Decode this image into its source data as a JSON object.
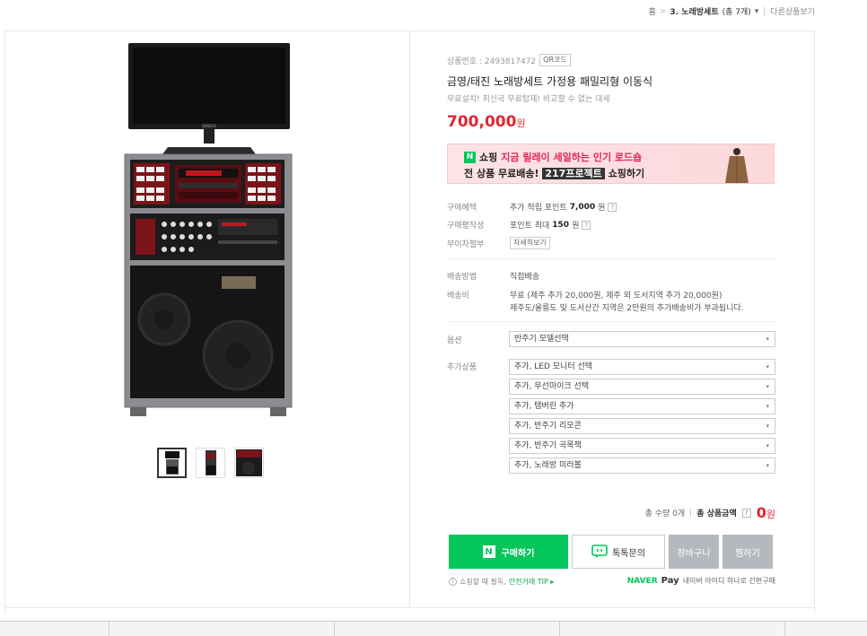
{
  "breadcrumb": {
    "home": "홈",
    "sep": ">",
    "category": "3. 노래방세트",
    "count": "(총 7개)",
    "dropdown": "▾",
    "other": "다른상품보기"
  },
  "product": {
    "number_label": "상품번호 : 2493817472",
    "qr_label": "QR코드",
    "title": "금영/태진 노래방세트 가정용 패밀리형 이동식",
    "subtitle": "무료설치! 최신곡 무료탑재! 비교할 수 없는 대세",
    "price": "700,000",
    "price_unit": "원",
    "monitor_brand": "SENSUS"
  },
  "banner": {
    "badge": "N",
    "line1_a": "쇼핑",
    "line1_b": "지금 릴레이 세일하는 인기 로드숍",
    "line2_a": "전 상품 무료배송!",
    "line2_b": "217프로젝트",
    "line2_c": "쇼핑하기"
  },
  "benefits": {
    "buy_label": "구매혜택",
    "buy_value_pre": "추가 적립 포인트",
    "buy_value_bold": "7,000",
    "buy_value_unit": "원",
    "review_label": "구매평작성",
    "review_value_pre": "포인트 최대",
    "review_value_bold": "150",
    "review_value_unit": "원",
    "installment_label": "무이자할부",
    "installment_btn": "자세히보기",
    "question": "?"
  },
  "delivery": {
    "method_label": "배송방법",
    "method_value": "직접배송",
    "fee_label": "배송비",
    "fee_line1": "무료 (제주 추가 20,000원, 제주 외 도서지역 추가 20,000원)",
    "fee_line2": "제주도/울릉도 및 도서산간 지역은 2만원의 추가배송비가 부과됩니다."
  },
  "options": {
    "option_label": "옵션",
    "option_select": "반주기 모델선택",
    "extra_label": "추가상품",
    "extras": [
      "추가, LED 모니터 선택",
      "추가, 무선마이크 선택",
      "추가, 탬버린 추가",
      "추가, 반주기 리모콘",
      "추가, 반주기 곡목책",
      "추가, 노래방 미러볼"
    ],
    "arrow": "▾"
  },
  "total": {
    "qty": "총 수량 0개",
    "label": "총 상품금액",
    "question": "?",
    "value": "0",
    "unit": "원"
  },
  "buttons": {
    "buy_badge": "N",
    "buy": "구매하기",
    "talk": "톡톡문의",
    "cart": "장바구니",
    "wish": "찜하기"
  },
  "footer": {
    "info_icon": "i",
    "notice": "쇼핑할 때 필독,",
    "safe_tip": "안전거래 TIP ▸",
    "naver": "NAVER",
    "pay": "Pay",
    "pay_desc": "네이버 아이디 하나로 간편구매"
  }
}
